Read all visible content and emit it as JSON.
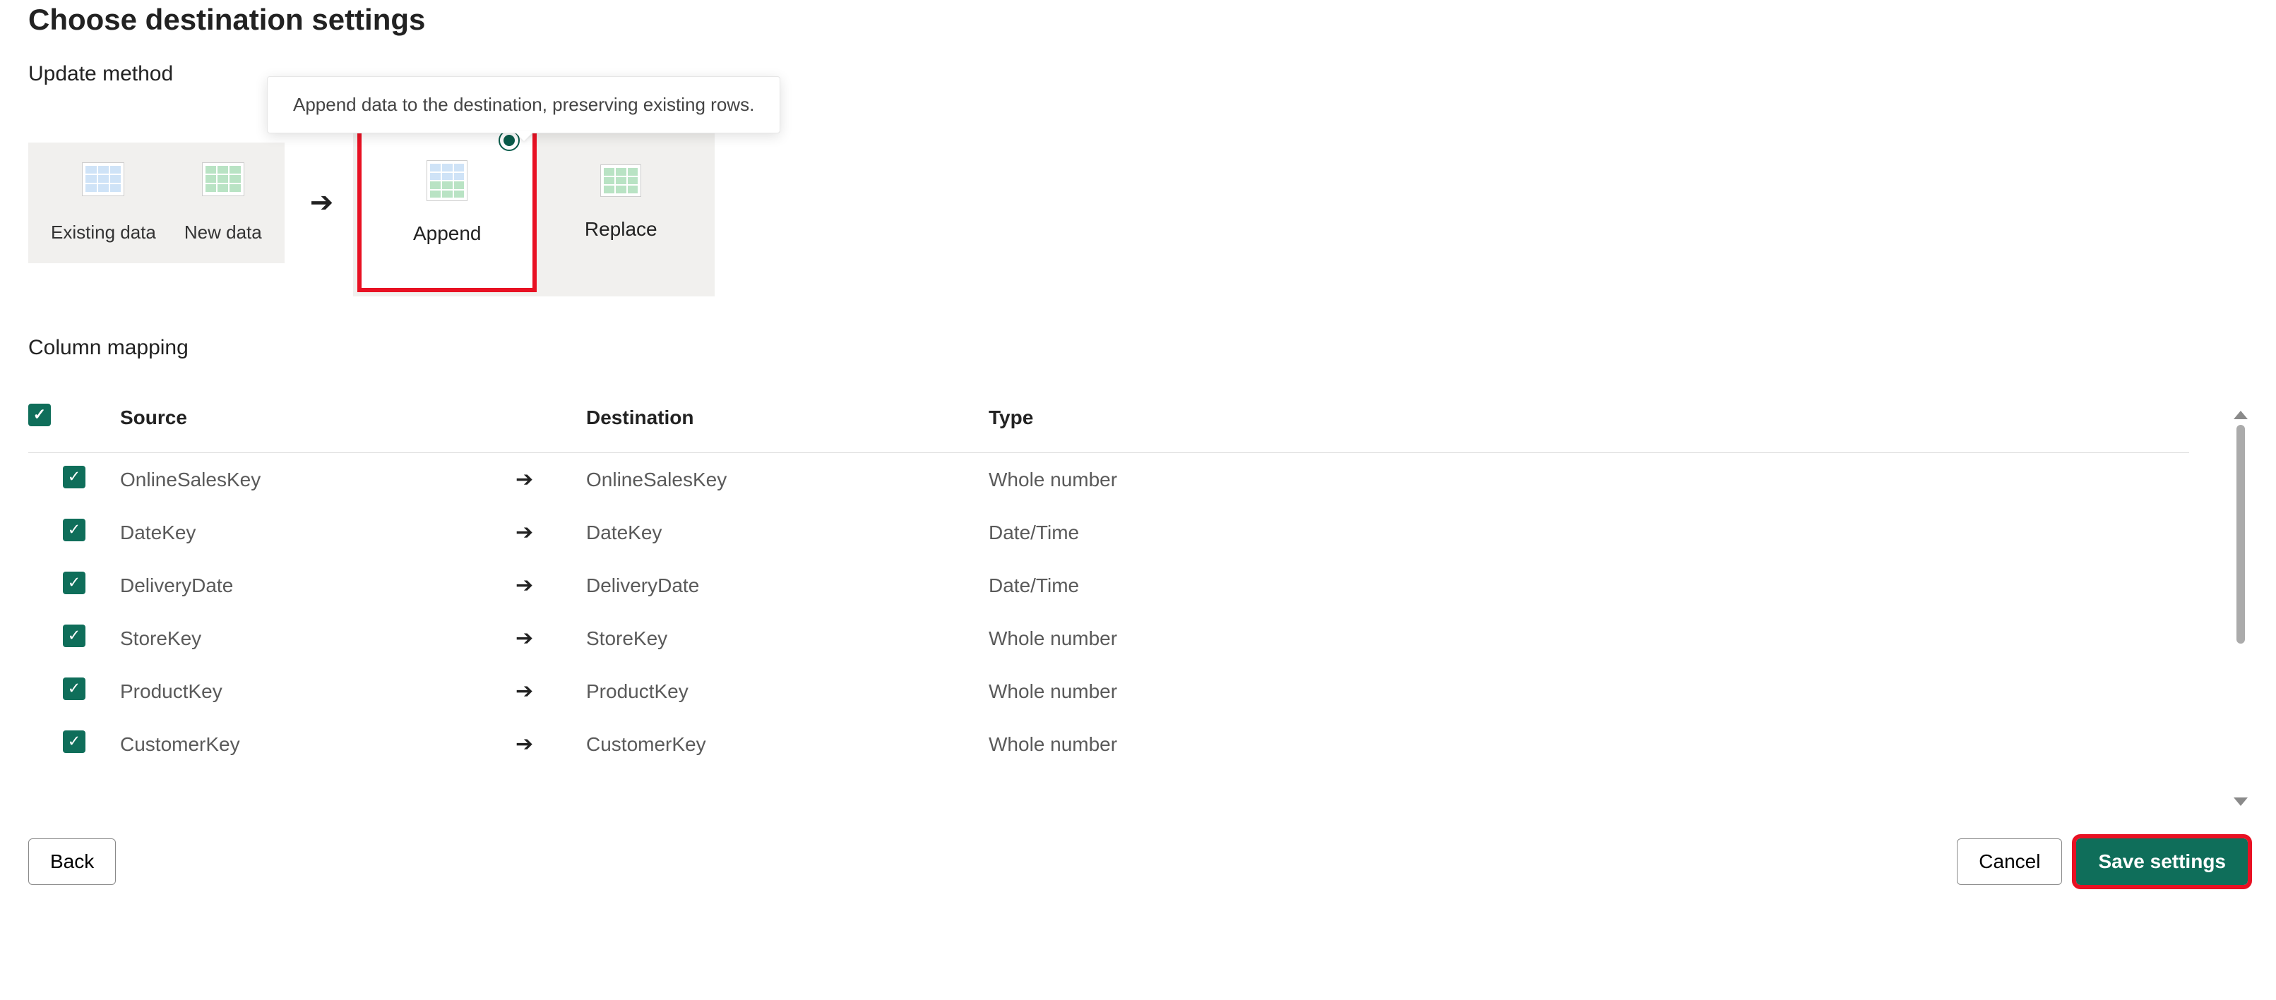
{
  "page_title": "Choose destination settings",
  "update_method": {
    "section_title": "Update method",
    "tooltip": "Append data to the destination, preserving existing rows.",
    "existing_label": "Existing data",
    "new_label": "New data",
    "options": {
      "append": "Append",
      "replace": "Replace"
    }
  },
  "column_mapping": {
    "section_title": "Column mapping",
    "headers": {
      "source": "Source",
      "destination": "Destination",
      "type": "Type"
    },
    "rows": [
      {
        "source": "OnlineSalesKey",
        "destination": "OnlineSalesKey",
        "type": "Whole number"
      },
      {
        "source": "DateKey",
        "destination": "DateKey",
        "type": "Date/Time"
      },
      {
        "source": "DeliveryDate",
        "destination": "DeliveryDate",
        "type": "Date/Time"
      },
      {
        "source": "StoreKey",
        "destination": "StoreKey",
        "type": "Whole number"
      },
      {
        "source": "ProductKey",
        "destination": "ProductKey",
        "type": "Whole number"
      },
      {
        "source": "CustomerKey",
        "destination": "CustomerKey",
        "type": "Whole number"
      }
    ]
  },
  "buttons": {
    "back": "Back",
    "cancel": "Cancel",
    "save": "Save settings"
  }
}
